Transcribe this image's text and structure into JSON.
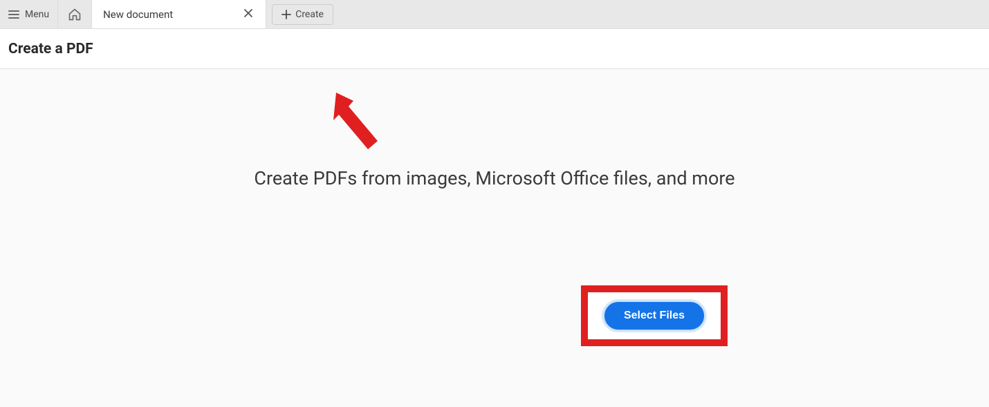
{
  "topbar": {
    "menu_label": "Menu",
    "tab_label": "New document",
    "create_label": "Create"
  },
  "header": {
    "title": "Create a PDF"
  },
  "main": {
    "hero_text": "Create PDFs from images, Microsoft Office files, and more",
    "select_files_label": "Select Files"
  }
}
